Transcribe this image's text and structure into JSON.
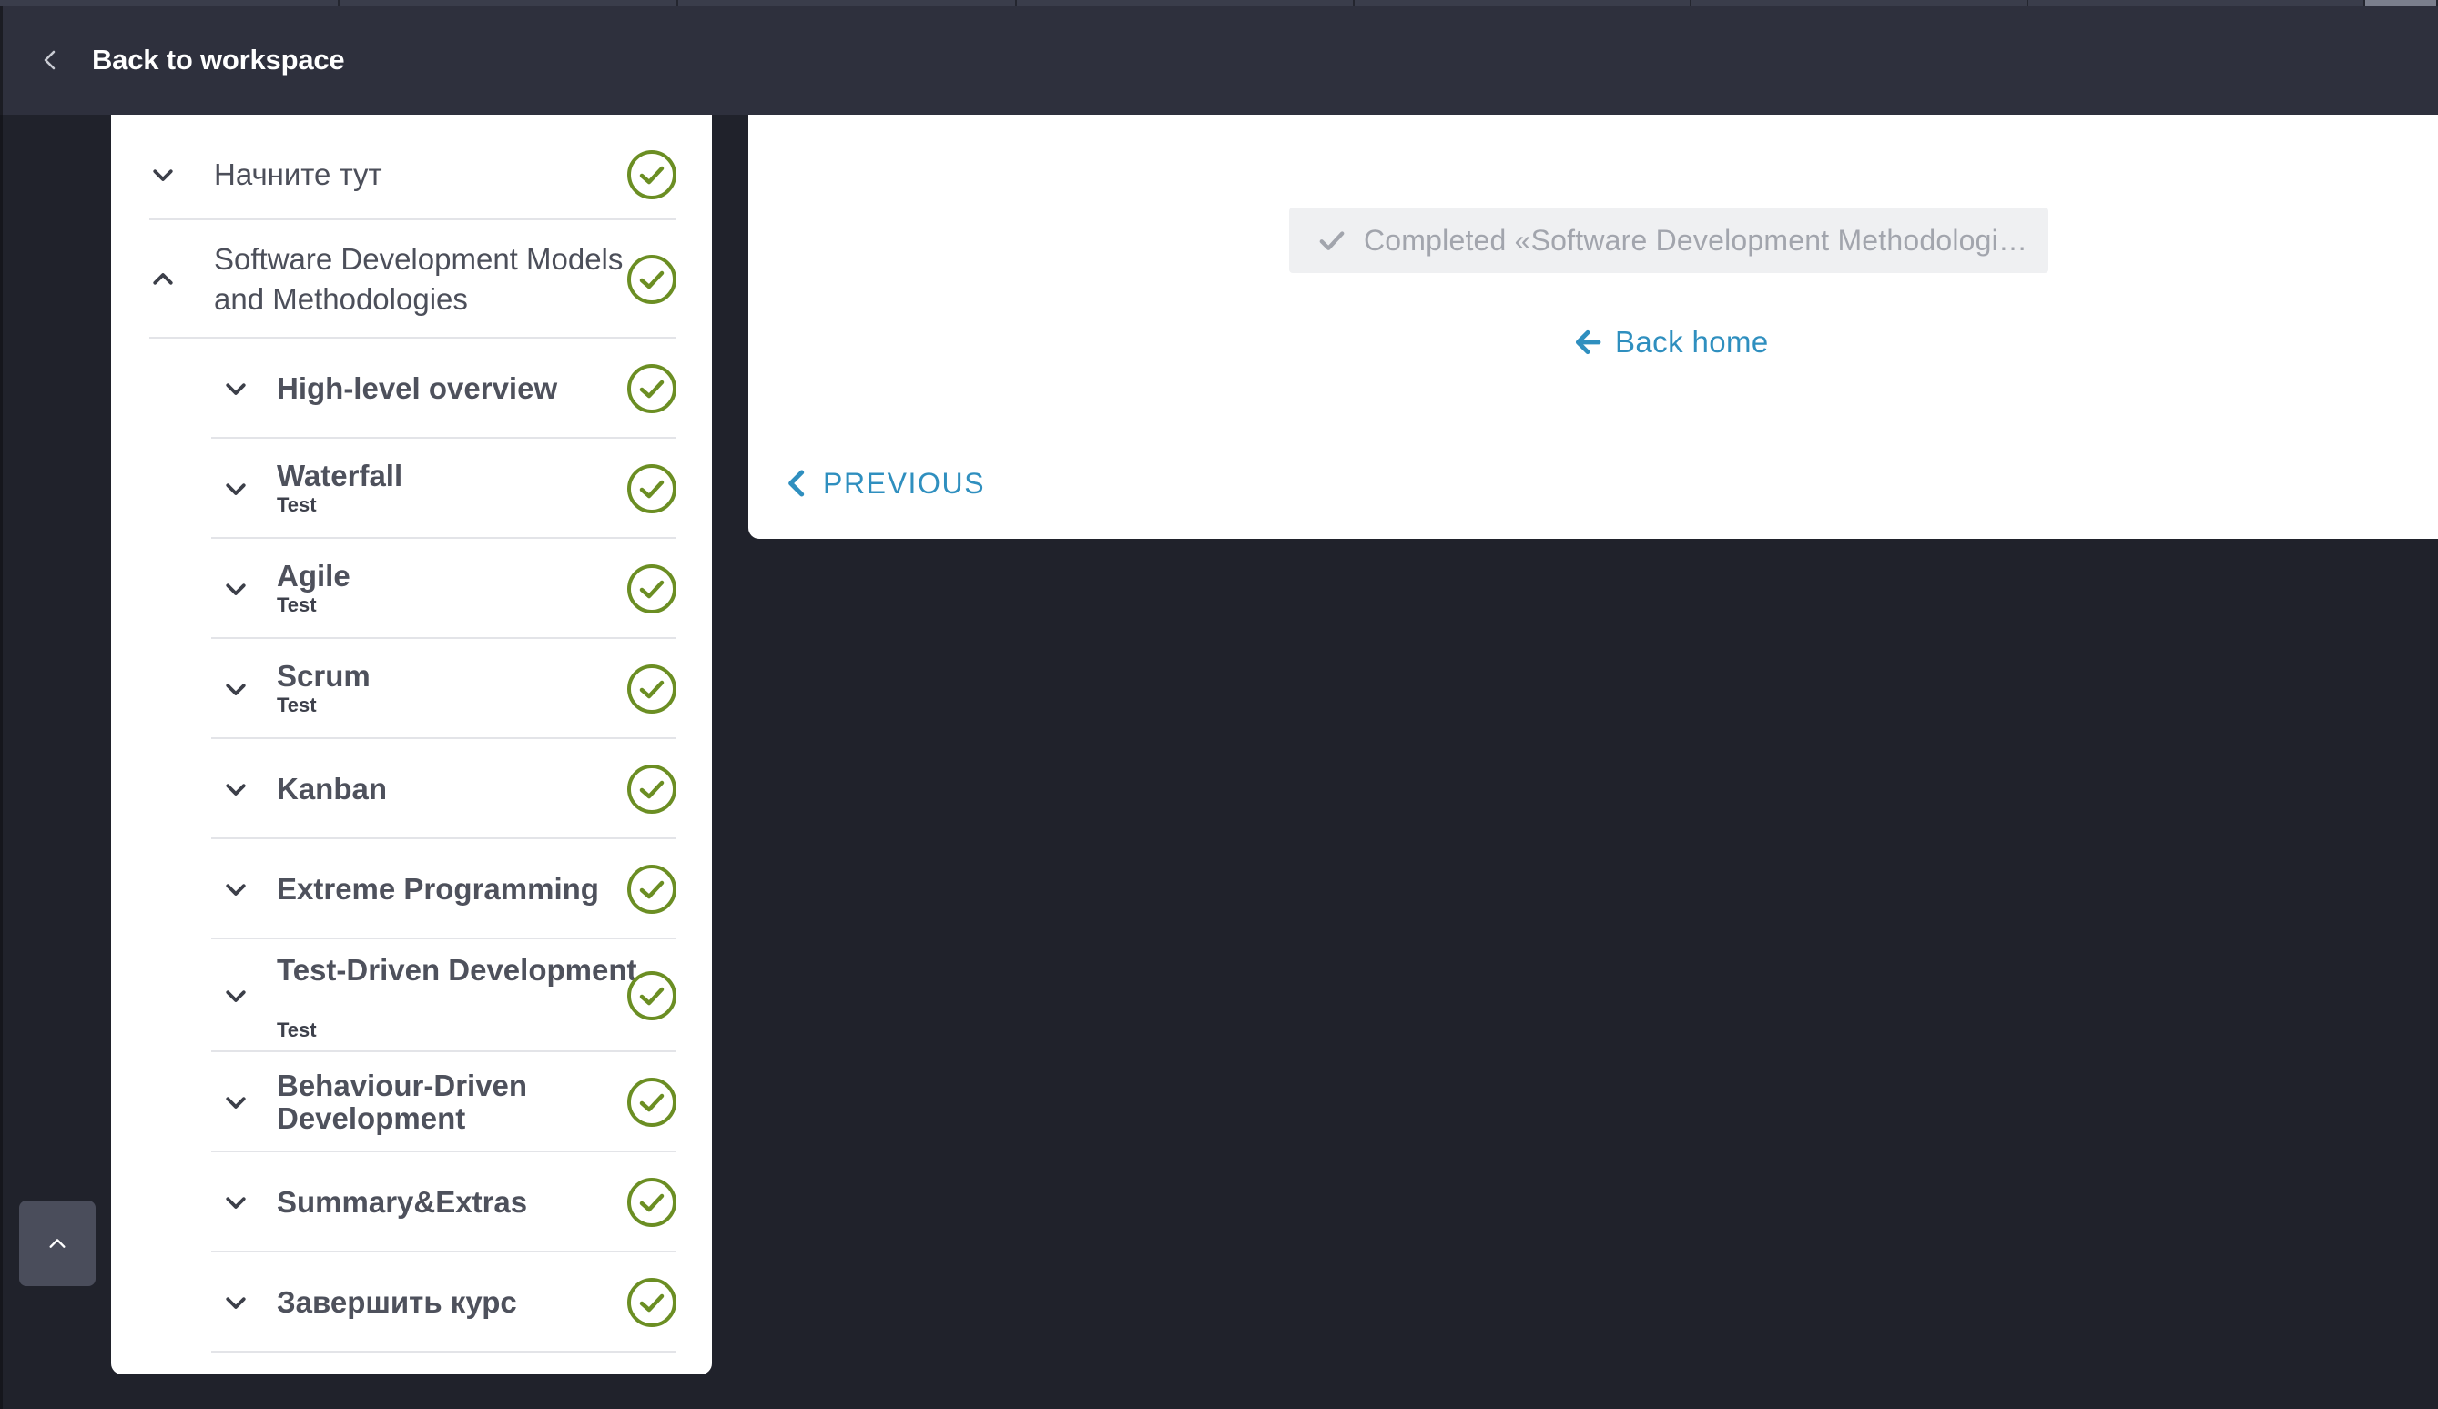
{
  "header": {
    "back_label": "Back to workspace"
  },
  "sidebar": {
    "sections": [
      {
        "title": "Начните тут",
        "expanded": false,
        "completed": true
      },
      {
        "title": "Software Development Models and Methodologies",
        "expanded": true,
        "completed": true
      }
    ],
    "lessons": [
      {
        "title": "High-level overview",
        "subtitle": "",
        "completed": true
      },
      {
        "title": "Waterfall",
        "subtitle": "Test",
        "completed": true
      },
      {
        "title": "Agile",
        "subtitle": "Test",
        "completed": true
      },
      {
        "title": "Scrum",
        "subtitle": "Test",
        "completed": true
      },
      {
        "title": "Kanban",
        "subtitle": "",
        "completed": true
      },
      {
        "title": "Extreme Programming",
        "subtitle": "",
        "completed": true
      },
      {
        "title": "Test-Driven Development",
        "subtitle": "Test",
        "completed": true
      },
      {
        "title": "Behaviour-Driven Development",
        "subtitle": "",
        "completed": true
      },
      {
        "title": "Summary&Extras",
        "subtitle": "",
        "completed": true
      },
      {
        "title": "Завершить курс",
        "subtitle": "",
        "completed": true
      }
    ]
  },
  "main": {
    "completed_label": "Completed «Software Development Methodologies»",
    "back_home_label": "Back home",
    "previous_label": "PREVIOUS"
  },
  "colors": {
    "check_green": "#6b8e23",
    "link_blue": "#2f8fbf",
    "header_bg": "#2e303d",
    "page_bg": "#20222b"
  }
}
